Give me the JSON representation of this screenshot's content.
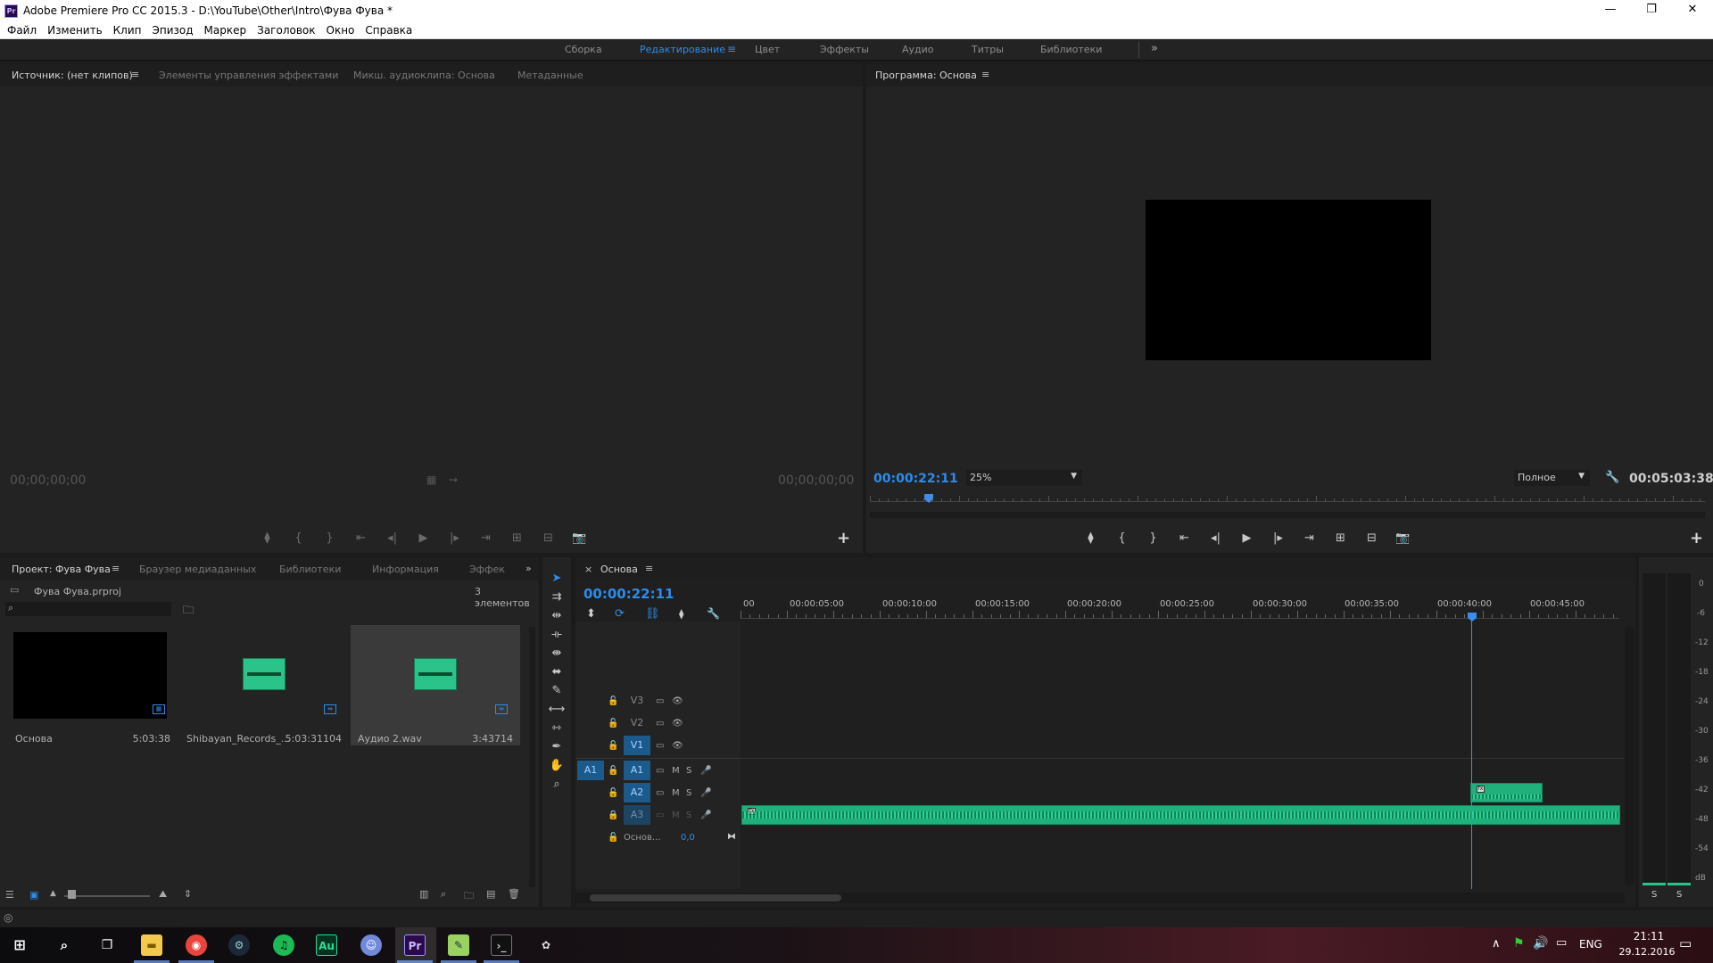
{
  "window": {
    "title": "Adobe Premiere Pro CC 2015.3 - D:\\YouTube\\Other\\Intro\\Фува Фува *",
    "logo_text": "Pr",
    "minimize_glyph": "—",
    "restore_glyph": "❐",
    "close_glyph": "✕"
  },
  "menu": [
    "Файл",
    "Изменить",
    "Клип",
    "Эпизод",
    "Маркер",
    "Заголовок",
    "Окно",
    "Справка"
  ],
  "workspaces": {
    "items": [
      "Сборка",
      "Редактирование",
      "Цвет",
      "Эффекты",
      "Аудио",
      "Титры",
      "Библиотеки"
    ],
    "active": "Редактирование",
    "menu_glyph": "≡",
    "more_glyph": "»"
  },
  "source_panel": {
    "tabs": [
      "Источник: (нет клипов)",
      "Элементы управления эффектами",
      "Микш. аудиоклипа: Основа",
      "Метаданные"
    ],
    "menu_glyph": "≡",
    "timecode_left": "00;00;00;00",
    "timecode_right": "00;00;00;00"
  },
  "program_panel": {
    "tab": "Программа: Основа",
    "menu_glyph": "≡",
    "timecode": "00:00:22:11",
    "zoom": "25%",
    "resolution": "Полное",
    "duration": "00:05:03:38",
    "playhead_fraction": 0.0706
  },
  "controls": {
    "marker": "⧫",
    "in": "{",
    "out": "}",
    "go_in": "⇤",
    "step_back": "◂|",
    "play": "▶",
    "step_fwd": "|▸",
    "go_out": "⇥",
    "insert": "⊞",
    "overwrite": "⊟",
    "export_frame": "📷",
    "plus": "+"
  },
  "project_panel": {
    "tabs": [
      "Проект: Фува Фува",
      "Браузер медиаданных",
      "Библиотеки",
      "Информация",
      "Эффек"
    ],
    "menu_glyph": "≡",
    "more_glyph": "»",
    "file": "Фува Фува.prproj",
    "count": "3 элементов",
    "items": [
      {
        "name": "Основа",
        "duration": "5:03:38",
        "kind": "video"
      },
      {
        "name": "Shibayan_Records_...",
        "duration": "5:03:31104",
        "kind": "audio"
      },
      {
        "name": "Аудио 2.wav",
        "duration": "3:43714",
        "kind": "audio"
      }
    ]
  },
  "timeline_panel": {
    "tab": "Основа",
    "close_glyph": "×",
    "menu_glyph": "≡",
    "timecode": "00:00:22:11",
    "ruler": [
      "00",
      "00:00:05:00",
      "00:00:10:00",
      "00:00:15:00",
      "00:00:20:00",
      "00:00:25:00",
      "00:00:30:00",
      "00:00:35:00",
      "00:00:40:00",
      "00:00:45:00"
    ],
    "tracks": {
      "video": [
        "V3",
        "V2",
        "V1"
      ],
      "audio": [
        "A1",
        "A2",
        "A3"
      ],
      "source_patch": "A1",
      "master_label": "Основ...",
      "master_value": "0,0",
      "mute_label": "M",
      "solo_label": "S"
    }
  },
  "vu_meter": {
    "scale": [
      "0",
      "-6",
      "-12",
      "-18",
      "-24",
      "-30",
      "-36",
      "-42",
      "-48",
      "-54",
      "dB"
    ],
    "solo_left": "S",
    "solo_right": "S"
  },
  "taskbar": {
    "language": "ENG",
    "time": "21:11",
    "date": "29.12.2016",
    "apps": [
      "Au",
      "Pr"
    ]
  },
  "colors": {
    "accent": "#2d8ceb",
    "audio_clip": "#1fb07c",
    "panel_bg": "#232323"
  }
}
